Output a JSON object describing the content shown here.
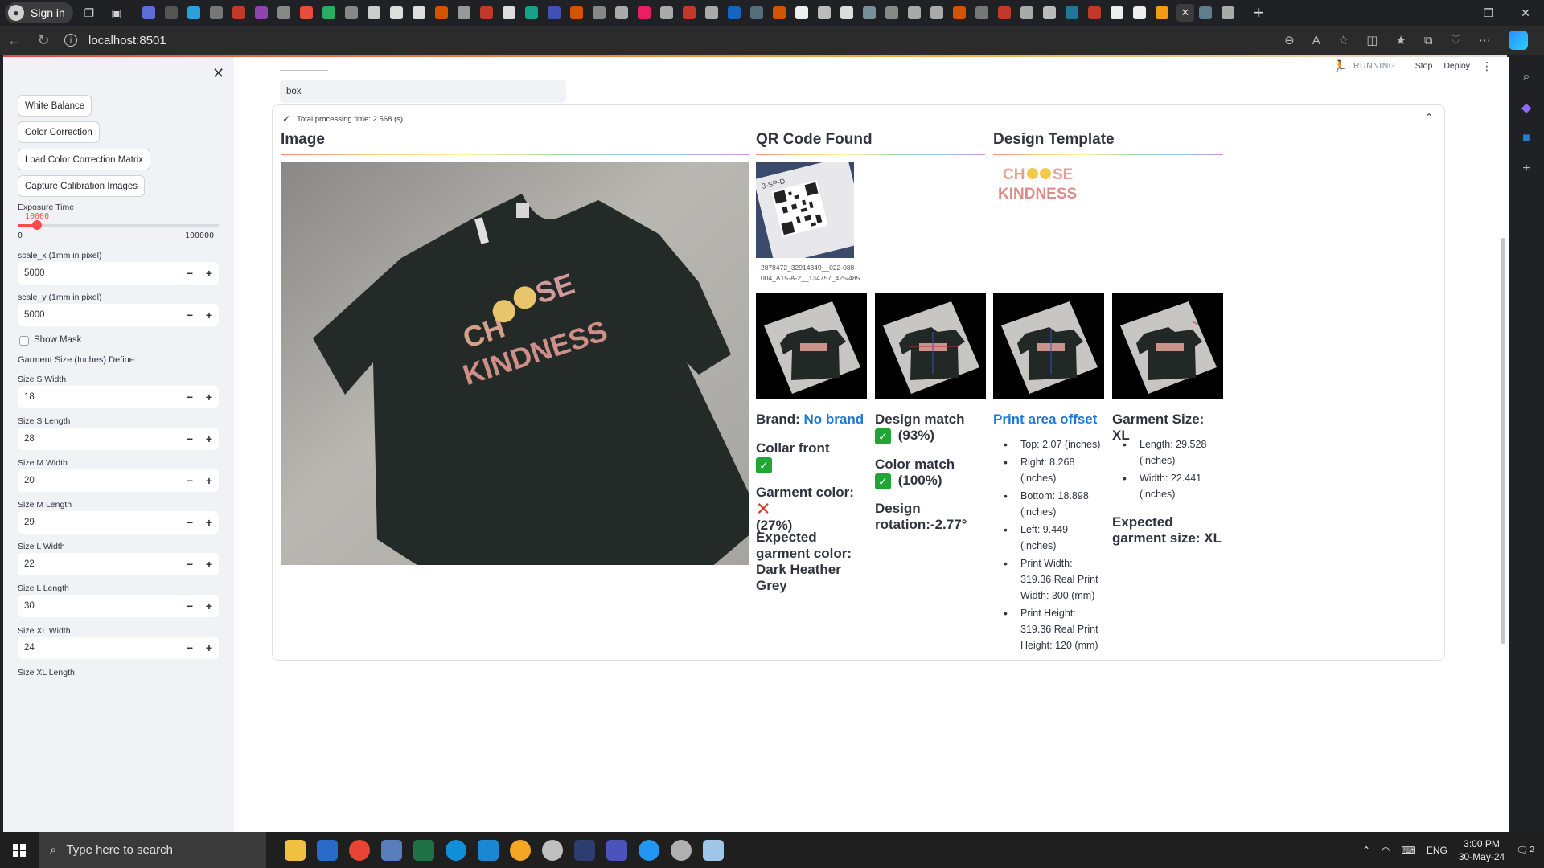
{
  "browser": {
    "signin_label": "Sign in",
    "url": "localhost:8501"
  },
  "sidebar": {
    "buttons": [
      "White Balance",
      "Color Correction",
      "Load Color Correction Matrix",
      "Capture Calibration Images"
    ],
    "exposure": {
      "label": "Exposure Time",
      "value": "10000",
      "min": "0",
      "max": "100000",
      "fraction": 0.1
    },
    "scale_x": {
      "label": "scale_x (1mm in pixel)",
      "value": "5000"
    },
    "scale_y": {
      "label": "scale_y (1mm in pixel)",
      "value": "5000"
    },
    "show_mask_label": "Show Mask",
    "garment_define_label": "Garment Size (Inches) Define:",
    "sizes": [
      {
        "label": "Size S Width",
        "value": "18"
      },
      {
        "label": "Size S Length",
        "value": "28"
      },
      {
        "label": "Size M Width",
        "value": "20"
      },
      {
        "label": "Size M Length",
        "value": "29"
      },
      {
        "label": "Size L Width",
        "value": "22"
      },
      {
        "label": "Size L Length",
        "value": "30"
      },
      {
        "label": "Size XL Width",
        "value": "24"
      }
    ],
    "last_label": "Size XL Length",
    "minus": "−",
    "plus": "+",
    "close": "✕"
  },
  "header": {
    "running": "RUNNING...",
    "stop": "Stop",
    "deploy": "Deploy",
    "menu": "⋮"
  },
  "main": {
    "top_field_value": "box",
    "processing_time": "Total processing time: 2.568 (s)",
    "columns": {
      "image": "Image",
      "qr": "QR Code Found",
      "template": "Design Template"
    },
    "qr_caption": "2878472_32914349__022-088-004_A15-A-2__134757_425/485",
    "template_text_1": "CH",
    "template_text_2": "SE",
    "template_text_3": "KINDNESS",
    "shirt_text_1": "CH",
    "shirt_text_2": "SE",
    "shirt_text_3": "KINDNESS",
    "results": {
      "brand_label": "Brand:",
      "brand_value": "No brand",
      "collar": "Collar front",
      "garment_color": "Garment color:",
      "garment_color_pct": "(27%)",
      "expected_color": "Expected garment color: Dark Heather Grey",
      "design_match": "Design match",
      "design_match_pct": "(93%)",
      "color_match": "Color match",
      "color_match_pct": "(100%)",
      "design_rotation": "Design rotation:-2.77°",
      "print_area_title": "Print area offset",
      "print_area": [
        "Top: 2.07 (inches)",
        "Right: 8.268 (inches)",
        "Bottom: 18.898 (inches)",
        "Left: 9.449 (inches)",
        "Print Width: 319.36 Real Print Width: 300 (mm)",
        "Print Height: 319.36 Real Print Height: 120 (mm)"
      ],
      "garment_size": "Garment Size: XL",
      "size_details": [
        "Length: 29.528 (inches)",
        "Width: 22.441 (inches)"
      ],
      "expected_size": "Expected garment size: XL"
    }
  },
  "taskbar": {
    "search_placeholder": "Type here to search",
    "lang": "ENG",
    "time": "3:00 PM",
    "date": "30-May-24",
    "notif_count": "2"
  }
}
